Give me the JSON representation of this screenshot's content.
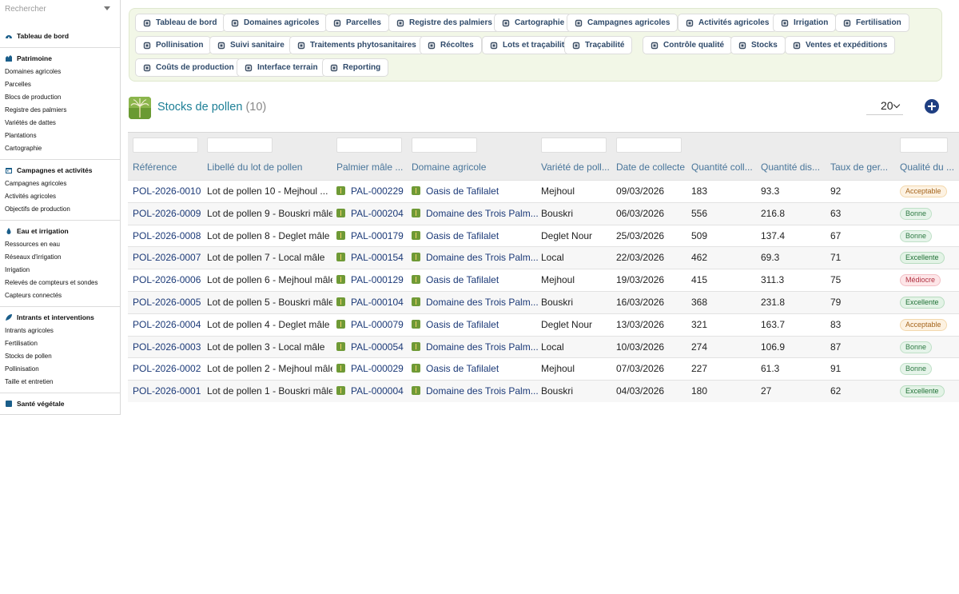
{
  "search": {
    "placeholder": "Rechercher"
  },
  "sidebar": {
    "top_item": "Tableau de bord",
    "sections": [
      {
        "title": "Patrimoine",
        "icon": "estate-icon",
        "items": [
          "Domaines agricoles",
          "Parcelles",
          "Blocs de production",
          "Registre des palmiers",
          "Variétés de dattes",
          "Plantations",
          "Cartographie"
        ]
      },
      {
        "title": "Campagnes et activités",
        "icon": "calendar-icon",
        "items": [
          "Campagnes agricoles",
          "Activités agricoles",
          "Objectifs de production"
        ]
      },
      {
        "title": "Eau et irrigation",
        "icon": "water-drop-icon",
        "items": [
          "Ressources en eau",
          "Réseaux d'irrigation",
          "Irrigation",
          "Relevés de compteurs et sondes",
          "Capteurs connectés"
        ]
      },
      {
        "title": "Intrants et interventions",
        "icon": "leaf-icon",
        "items": [
          "Intrants agricoles",
          "Fertilisation",
          "Stocks de pollen",
          "Pollinisation",
          "Taille et entretien"
        ]
      },
      {
        "title": "Santé végétale",
        "icon": "health-icon",
        "items": []
      }
    ]
  },
  "toolbar": {
    "row1": [
      "Tableau de bord",
      "Domaines agricoles",
      "Parcelles",
      "Registre des palmiers",
      "Cartographie",
      "Campagnes agricoles",
      "Activités agricoles",
      "Irrigation",
      "Fertilisation"
    ],
    "row2": [
      "Pollinisation",
      "Suivi sanitaire",
      "Traitements phytosanitaires",
      "Récoltes",
      "Lots et traçabilité",
      "Traçabilité",
      "Contrôle qualité",
      "Stocks",
      "Ventes et expéditions"
    ],
    "row3": [
      "Coûts de production",
      "Interface terrain",
      "Reporting"
    ]
  },
  "header": {
    "title": "Stocks de pollen",
    "count": "(10)",
    "page_size": "20"
  },
  "table": {
    "columns": [
      "Référence",
      "Libellé du lot de pollen",
      "Palmier mâle ...",
      "Domaine agricole",
      "Variété de poll...",
      "Date de collecte",
      "Quantité coll...",
      "Quantité dis...",
      "Taux de ger...",
      "Qualité du ..."
    ],
    "rows": [
      {
        "ref": "POL-2026-0010",
        "label": "Lot de pollen 10 - Mejhoul ...",
        "palm": "PAL-000229",
        "domain": "Oasis de Tafilalet",
        "variety": "Mejhoul",
        "date": "09/03/2026",
        "qty_collected": "183",
        "qty_available": "93.3",
        "germ_rate": "92",
        "quality": "Acceptable"
      },
      {
        "ref": "POL-2026-0009",
        "label": "Lot de pollen 9 - Bouskri mâle",
        "palm": "PAL-000204",
        "domain": "Domaine des Trois Palm...",
        "variety": "Bouskri",
        "date": "06/03/2026",
        "qty_collected": "556",
        "qty_available": "216.8",
        "germ_rate": "63",
        "quality": "Bonne"
      },
      {
        "ref": "POL-2026-0008",
        "label": "Lot de pollen 8 - Deglet mâle",
        "palm": "PAL-000179",
        "domain": "Oasis de Tafilalet",
        "variety": "Deglet Nour",
        "date": "25/03/2026",
        "qty_collected": "509",
        "qty_available": "137.4",
        "germ_rate": "67",
        "quality": "Bonne"
      },
      {
        "ref": "POL-2026-0007",
        "label": "Lot de pollen 7 - Local mâle",
        "palm": "PAL-000154",
        "domain": "Domaine des Trois Palm...",
        "variety": "Local",
        "date": "22/03/2026",
        "qty_collected": "462",
        "qty_available": "69.3",
        "germ_rate": "71",
        "quality": "Excellente"
      },
      {
        "ref": "POL-2026-0006",
        "label": "Lot de pollen 6 - Mejhoul mâle",
        "palm": "PAL-000129",
        "domain": "Oasis de Tafilalet",
        "variety": "Mejhoul",
        "date": "19/03/2026",
        "qty_collected": "415",
        "qty_available": "311.3",
        "germ_rate": "75",
        "quality": "Médiocre"
      },
      {
        "ref": "POL-2026-0005",
        "label": "Lot de pollen 5 - Bouskri mâle",
        "palm": "PAL-000104",
        "domain": "Domaine des Trois Palm...",
        "variety": "Bouskri",
        "date": "16/03/2026",
        "qty_collected": "368",
        "qty_available": "231.8",
        "germ_rate": "79",
        "quality": "Excellente"
      },
      {
        "ref": "POL-2026-0004",
        "label": "Lot de pollen 4 - Deglet mâle",
        "palm": "PAL-000079",
        "domain": "Oasis de Tafilalet",
        "variety": "Deglet Nour",
        "date": "13/03/2026",
        "qty_collected": "321",
        "qty_available": "163.7",
        "germ_rate": "83",
        "quality": "Acceptable"
      },
      {
        "ref": "POL-2026-0003",
        "label": "Lot de pollen 3 - Local mâle",
        "palm": "PAL-000054",
        "domain": "Domaine des Trois Palm...",
        "variety": "Local",
        "date": "10/03/2026",
        "qty_collected": "274",
        "qty_available": "106.9",
        "germ_rate": "87",
        "quality": "Bonne"
      },
      {
        "ref": "POL-2026-0002",
        "label": "Lot de pollen 2 - Mejhoul mâle",
        "palm": "PAL-000029",
        "domain": "Oasis de Tafilalet",
        "variety": "Mejhoul",
        "date": "07/03/2026",
        "qty_collected": "227",
        "qty_available": "61.3",
        "germ_rate": "91",
        "quality": "Bonne"
      },
      {
        "ref": "POL-2026-0001",
        "label": "Lot de pollen 1 - Bouskri mâle",
        "palm": "PAL-000004",
        "domain": "Domaine des Trois Palm...",
        "variety": "Bouskri",
        "date": "04/03/2026",
        "qty_collected": "180",
        "qty_available": "27",
        "germ_rate": "62",
        "quality": "Excellente"
      }
    ]
  },
  "colors": {
    "accent": "#1d7f96",
    "link": "#1c3a78",
    "toolbar_bg": "#f2f7e7",
    "add_button": "#1f3f82"
  }
}
